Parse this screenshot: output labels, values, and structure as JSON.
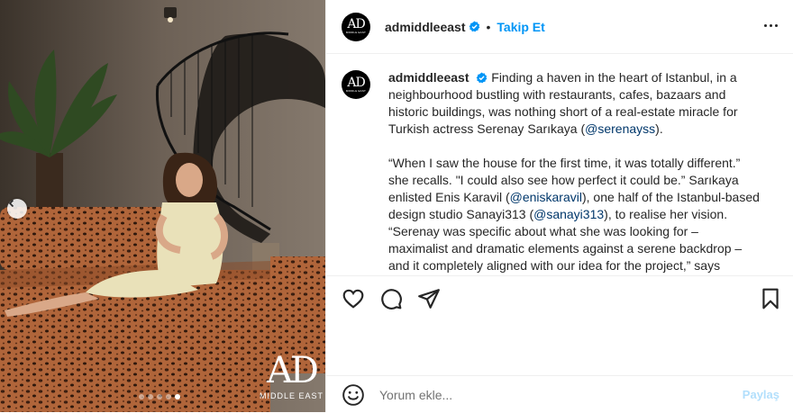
{
  "photo": {
    "dots_total": 5,
    "active_dot": 5,
    "logo_main": "AD",
    "logo_sub": "MIDDLE EAST"
  },
  "header": {
    "avatar_text": "AD",
    "avatar_sub": "MIDDLE EAST",
    "username": "admiddleeast",
    "separator": "•",
    "follow_label": "Takip Et"
  },
  "caption": {
    "username": "admiddleeast",
    "line1": "Finding a haven in the heart of Istanbul, in a",
    "line2": "neighbourhood bustling with restaurants, cafes, bazaars and",
    "line3": "historic buildings, was nothing short of a real-estate miracle for",
    "line4_pre": "Turkish actress Serenay Sarıkaya (",
    "line4_mention": "@serenayss",
    "line4_post": ").",
    "line6": "“When I saw the house for the first time, it was totally different.”",
    "line7": "she recalls. \"I could also see how perfect it could be.” Sarıkaya",
    "line8_pre": "enlisted Enis Karavil (",
    "line8_mention": "@eniskaravil",
    "line8_post": "), one half of the Istanbul-based",
    "line9_pre": "design studio Sanayi313 (",
    "line9_mention": "@sanayi313",
    "line9_post": "), to realise her vision.",
    "line10": "“Serenay was specific about what she was looking for –",
    "line11": "maximalist and dramatic elements against a serene backdrop –",
    "line12": "and it completely aligned with our idea for the project,” says"
  },
  "actions": {
    "icons": [
      "heart-icon",
      "comment-icon",
      "share-icon",
      "bookmark-icon"
    ]
  },
  "comment": {
    "placeholder": "Yorum ekle...",
    "post_label": "Paylaş"
  },
  "colors": {
    "accent": "#0095f6",
    "mention": "#00376b",
    "post_disabled": "#b2dffc",
    "text": "#262626"
  }
}
